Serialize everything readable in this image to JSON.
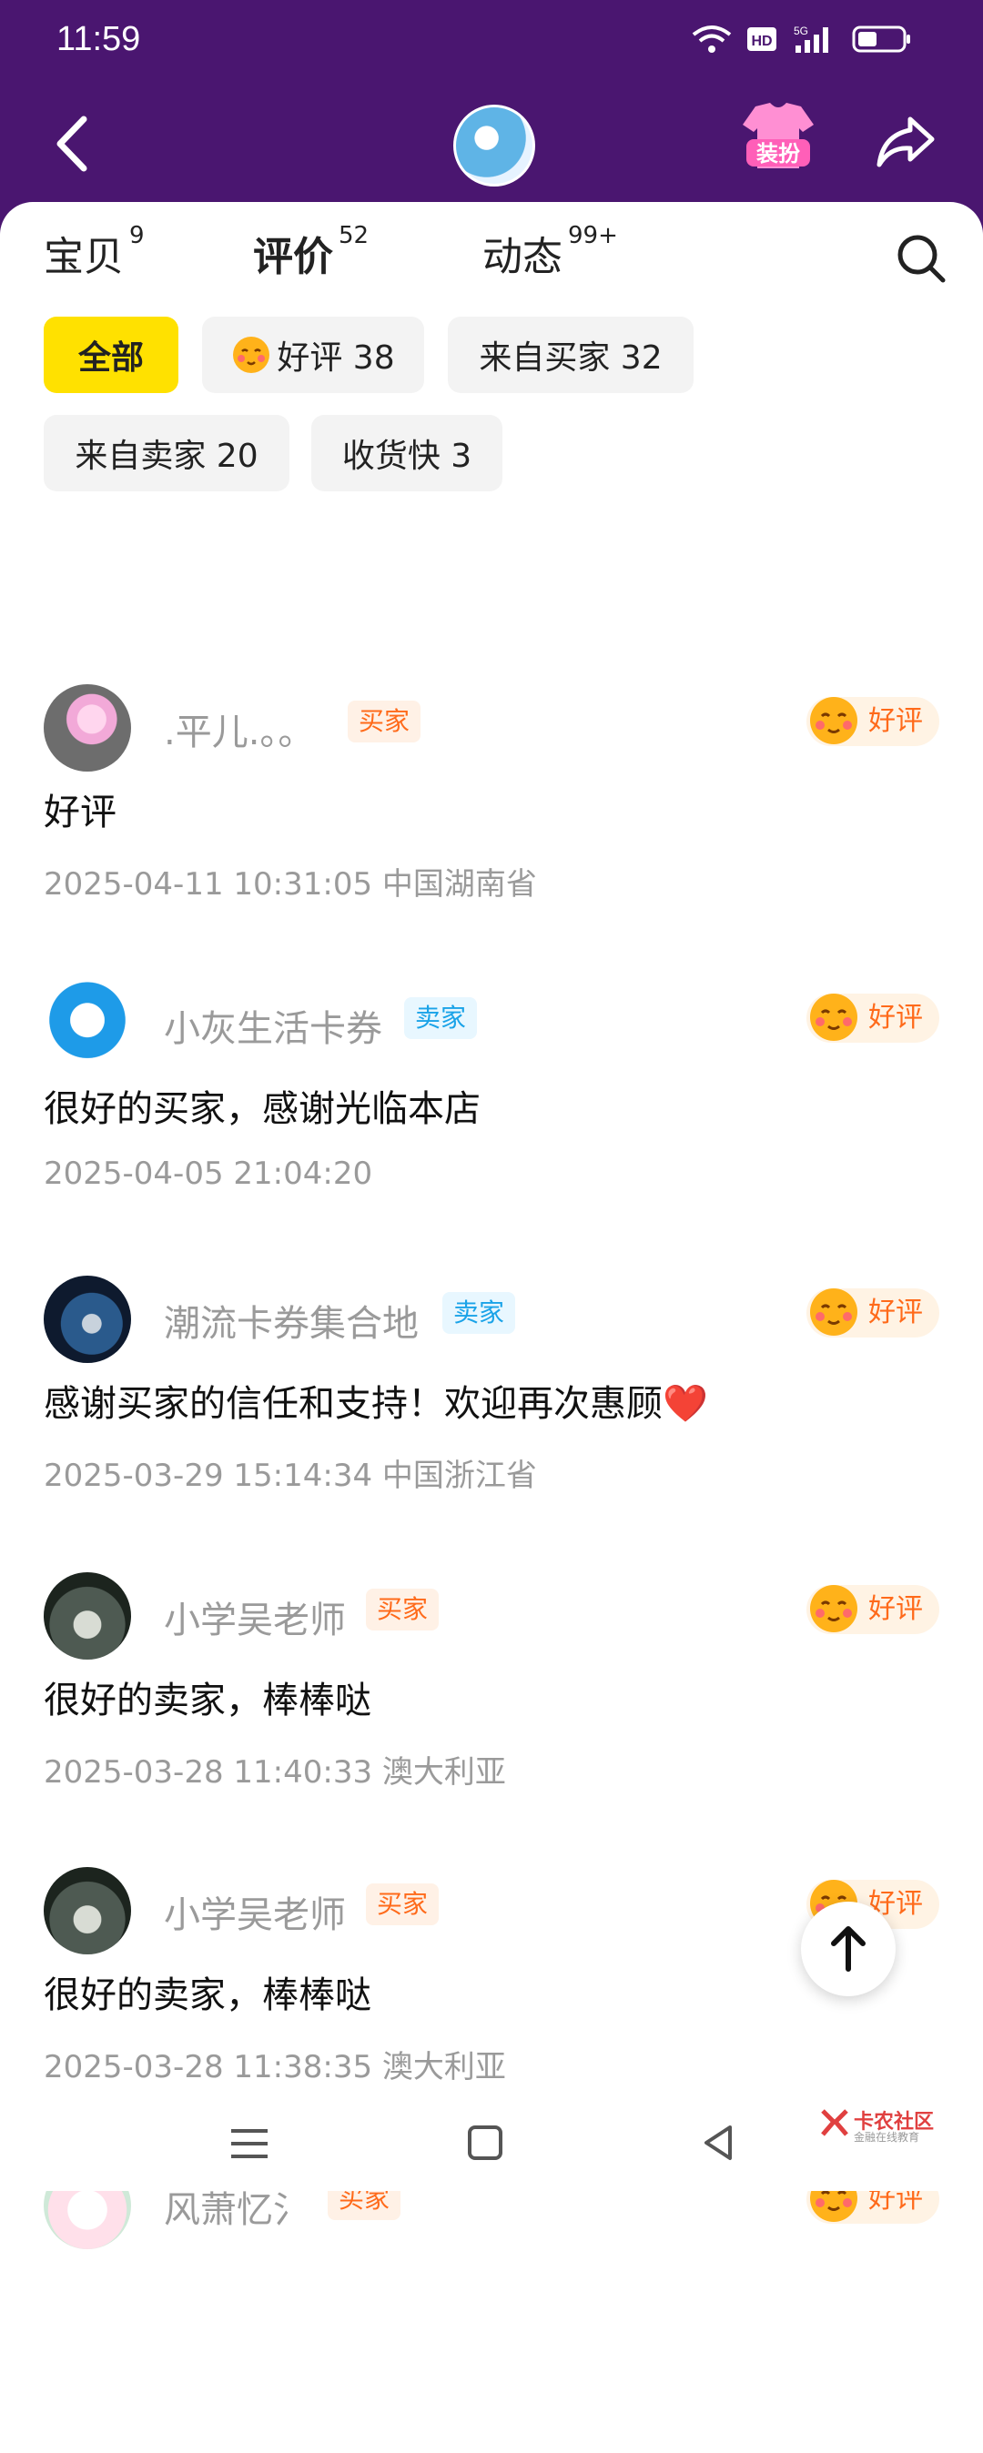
{
  "status_bar": {
    "time": "11:59",
    "icons": [
      "wifi-icon",
      "hd-icon",
      "5g-signal-icon",
      "battery-icon"
    ]
  },
  "header": {
    "icons": [
      "back-icon",
      "shop-avatar",
      "dress-up-icon",
      "share-icon"
    ],
    "dress_label": "装扮"
  },
  "tabs": [
    {
      "label": "宝贝",
      "count": "9"
    },
    {
      "label": "评价",
      "count": "52"
    },
    {
      "label": "动态",
      "count": "99+"
    }
  ],
  "filters": [
    {
      "label": "全部"
    },
    {
      "label": "好评 38"
    },
    {
      "label": "来自买家 32"
    },
    {
      "label": "来自卖家 20"
    },
    {
      "label": "收货快 3"
    }
  ],
  "reviews": [
    {
      "user": ".平儿.。。",
      "role": "买家",
      "rating": "好评",
      "content": "好评",
      "date": "2025-04-11 10:31:05",
      "location": "中国湖南省"
    },
    {
      "user": "小灰生活卡券",
      "role": "卖家",
      "rating": "好评",
      "content": "很好的买家，感谢光临本店",
      "date": "2025-04-05 21:04:20",
      "location": ""
    },
    {
      "user": "潮流卡券集合地",
      "role": "卖家",
      "rating": "好评",
      "content": "感谢买家的信任和支持！欢迎再次惠顾❤️",
      "date": "2025-03-29 15:14:34",
      "location": "中国浙江省"
    },
    {
      "user": "小学吴老师",
      "role": "买家",
      "rating": "好评",
      "content": "很好的卖家，棒棒哒",
      "date": "2025-03-28 11:40:33",
      "location": "澳大利亚"
    },
    {
      "user": "小学吴老师",
      "role": "买家",
      "rating": "好评",
      "content": "很好的卖家，棒棒哒",
      "date": "2025-03-28 11:38:35",
      "location": "澳大利亚"
    },
    {
      "user": "风萧忆氵",
      "role": "买家",
      "rating": "好评",
      "content": "",
      "date": "",
      "location": ""
    }
  ],
  "watermark": {
    "main": "卡农社区",
    "sub": "金融在线教育"
  },
  "colors": {
    "header_bg": "#4a1670",
    "accent_yellow": "#ffe100",
    "buyer_badge": "#ff6a1a",
    "seller_badge": "#1aa3e8"
  }
}
